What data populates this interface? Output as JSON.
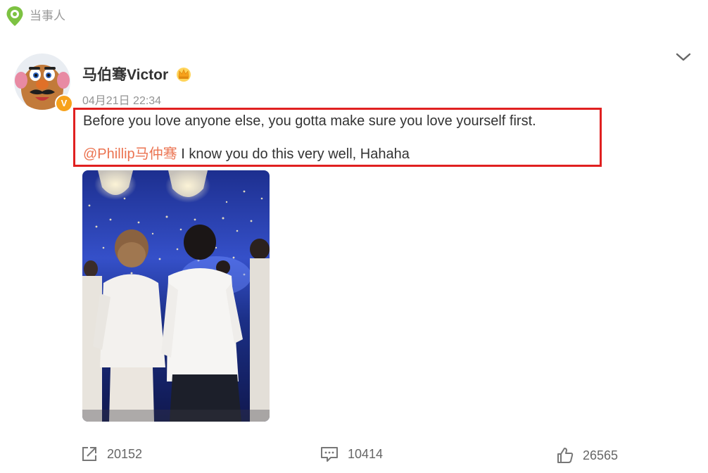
{
  "topic": {
    "label": "当事人",
    "icon": "location-pin-icon"
  },
  "post": {
    "author": "马伯骞Victor",
    "verified_badge": "V",
    "timestamp": "04月21日 22:34",
    "text_line1": "Before you love anyone else, you gotta make sure you love yourself first.",
    "mention": "@Phillip马仲骞",
    "text_line2_rest": " I know you do this very well, Hahaha",
    "highlight_color": "#e02020",
    "mention_color": "#eb7350"
  },
  "actions": {
    "repost_count": "20152",
    "comment_count": "10414",
    "like_count": "26565"
  }
}
